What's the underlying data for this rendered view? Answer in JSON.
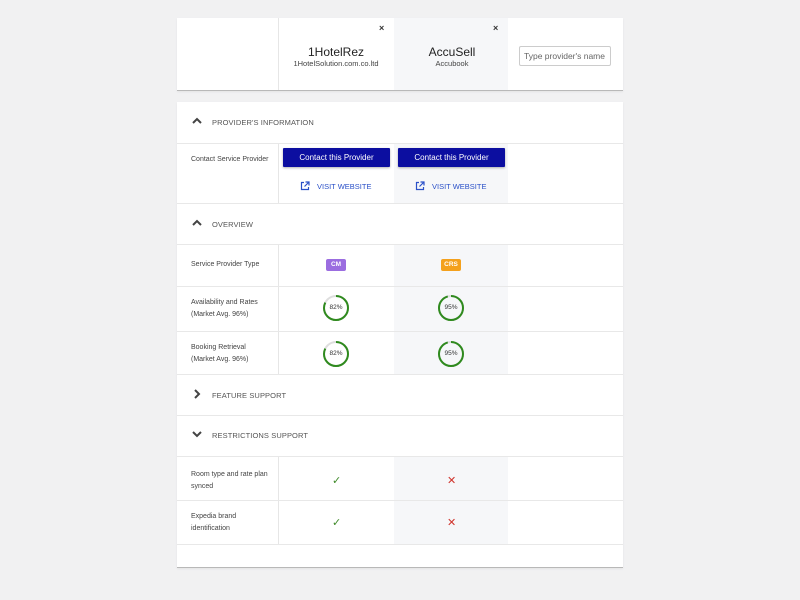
{
  "providers": [
    {
      "name": "1HotelRez",
      "subtitle": "1HotelSolution.com.co.ltd",
      "close": "×",
      "type_badge": "CM",
      "type_color": "#9b6de0",
      "availability_pct": 0.82,
      "availability_label": "82%",
      "booking_pct": 0.82,
      "booking_label": "82%",
      "room_type_synced": "✓",
      "brand_identification": "✓"
    },
    {
      "name": "AccuSell",
      "subtitle": "Accubook",
      "close": "×",
      "type_badge": "CRS",
      "type_color": "#f4a11d",
      "availability_pct": 0.95,
      "availability_label": "95%",
      "booking_pct": 0.95,
      "booking_label": "95%",
      "room_type_synced": "✕",
      "brand_identification": "✕"
    }
  ],
  "search": {
    "placeholder": "Type provider's name"
  },
  "sections": {
    "provider_info": "PROVIDER'S INFORMATION",
    "overview": "OVERVIEW",
    "feature_support": "FEATURE SUPPORT",
    "restrictions_support": "RESTRICTIONS SUPPORT"
  },
  "rows": {
    "contact_label": "Contact Service Provider",
    "contact_button": "Contact this Provider",
    "visit_website": "VISIT WEBSITE",
    "type_label": "Service Provider Type",
    "availability_label": "Availability and Rates",
    "availability_sub": "(Market Avg. 96%)",
    "booking_label": "Booking Retrieval",
    "booking_sub": "(Market Avg. 96%)",
    "room_type_label": "Room type and rate plan synced",
    "brand_label": "Expedia brand identification"
  },
  "colors": {
    "accent": "#0c0ea0",
    "ring": "#2f8a1e",
    "check": "#3f8a2a",
    "cross": "#d0342c",
    "link": "#2a50c8"
  }
}
